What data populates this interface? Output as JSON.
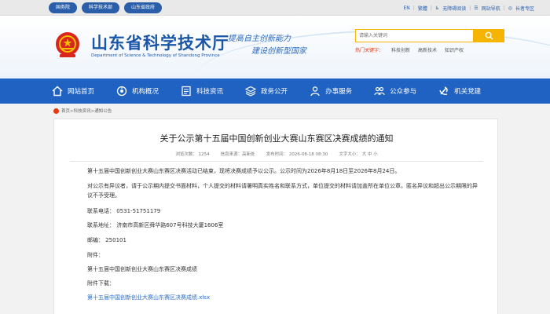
{
  "topbar": {
    "links": [
      "国务院",
      "科学技术部",
      "山东省政府"
    ],
    "right": [
      "EN",
      "繁體",
      "无障碍阅读",
      "网站导航",
      "长者专区"
    ]
  },
  "header": {
    "site_title": "山东省科学技术厅",
    "site_subtitle": "Department of Science & Technology of Shandong Province",
    "slogan_line1": "提高自主创新能力",
    "slogan_line2": "建设创新型国家",
    "search_placeholder": "请输入关键词",
    "hot_label": "热门关键字：",
    "hot_words": [
      "科技创新",
      "高新技术",
      "知识产权"
    ]
  },
  "nav": {
    "items": [
      "网站首页",
      "机构概况",
      "科技资讯",
      "政务公开",
      "办事服务",
      "公众参与",
      "机关党建"
    ]
  },
  "breadcrumb": "首页>科技资讯>通知公告",
  "article": {
    "title": "关于公示第十五届中国创新创业大赛山东赛区决赛成绩的通知",
    "meta": {
      "views": "浏览次数：  1254",
      "source": "信息来源：高新处",
      "date": "发布时间：  2026-08-18 08:30",
      "font_size": "文字大小：  大  中  小"
    },
    "para1": "第十五届中国创新创业大赛山东赛区决赛活动已结束，现将决赛成绩予以公示。公示时间为2026年8月18日至2026年8月24日。",
    "para2": "对公示有异议者，请于公示期内提交书面材料，个人提交的材料请署明真实姓名和联系方式，单位提交的材料请加盖所在单位公章。匿名异议和超出公示期限的异议不予受理。",
    "phone": "联系电话：  0531-51751179",
    "address": "联系地址：  济南市高新区舜华路607号科技大厦1606室",
    "postcode": "邮编：  250101",
    "attachment_label": "附件：",
    "attachment_name": "第十五届中国创新创业大赛山东赛区决赛成绩",
    "download_label": "附件下载：",
    "download_file": "第十五届中国创新创业大赛山东赛区决赛成绩.xlsx"
  },
  "colors": {
    "brand_blue": "#1f62c2",
    "accent_yellow": "#f5b400",
    "hot_red": "#e8380d"
  }
}
